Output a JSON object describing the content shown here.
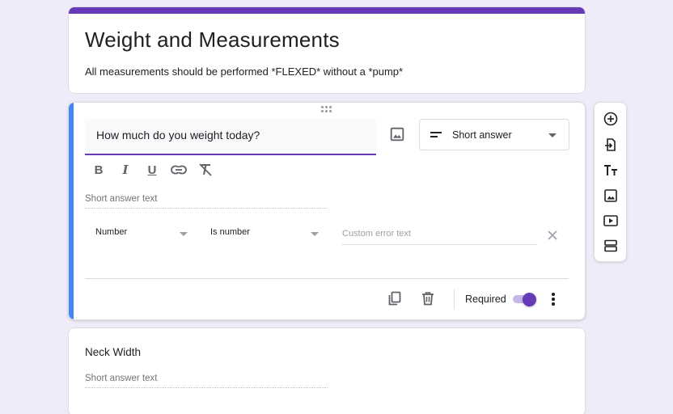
{
  "form": {
    "title": "Weight and Measurements",
    "description": "All measurements should be performed *FLEXED* without a *pump*"
  },
  "question1": {
    "text": "How much do you weight today?",
    "type": "Short answer",
    "answer_placeholder": "Short answer text",
    "validation": {
      "type": "Number",
      "condition": "Is number",
      "error_placeholder": "Custom error text"
    },
    "required_label": "Required",
    "required": true
  },
  "question2": {
    "text": "Neck Width",
    "answer_placeholder": "Short answer text"
  },
  "toolbar": {
    "items": [
      "add-question-icon",
      "import-questions-icon",
      "add-title-icon",
      "add-image-icon",
      "add-video-icon",
      "add-section-icon"
    ]
  },
  "colors": {
    "accent": "#673ab7",
    "background": "#f0ebf8",
    "active_bar": "#4285f4"
  }
}
